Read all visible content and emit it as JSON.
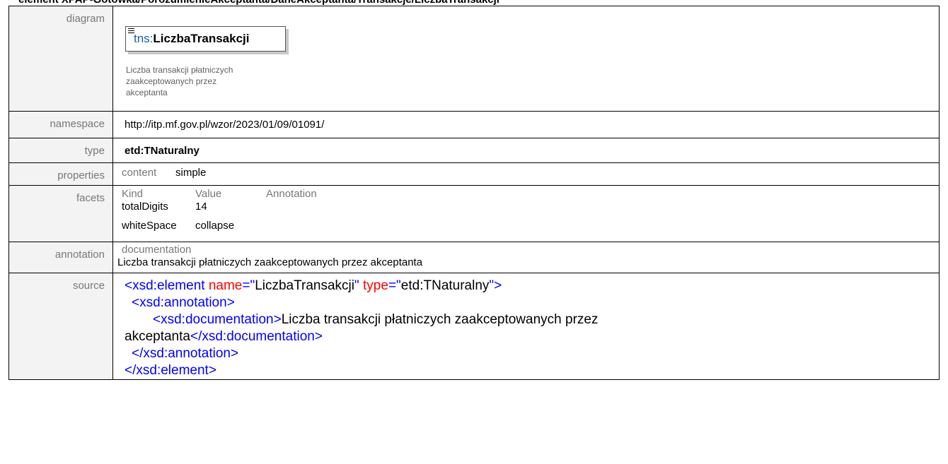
{
  "page": {
    "title": "element XPAP-Gotowka/PorozumienieAkceptanta/DaneAkceptanta/Transakcje/LiczbaTransakcji"
  },
  "labels": {
    "diagram": "diagram",
    "namespace": "namespace",
    "type": "type",
    "properties": "properties",
    "facets": "facets",
    "annotation": "annotation",
    "source": "source"
  },
  "diagram": {
    "prefix": "tns:",
    "name": "LiczbaTransakcji",
    "doc": "Liczba transakcji płatniczych zaakceptowanych przez akceptanta"
  },
  "namespace": "http://itp.mf.gov.pl/wzor/2023/01/09/01091/",
  "type": "etd:TNaturalny",
  "properties": {
    "key": "content",
    "value": "simple"
  },
  "facets": {
    "headers": [
      "Kind",
      "Value",
      "Annotation"
    ],
    "rows": [
      {
        "kind": "totalDigits",
        "value": "14"
      },
      {
        "kind": "whiteSpace",
        "value": "collapse"
      }
    ]
  },
  "annotation": {
    "head": "documentation",
    "text": "Liczba transakcji płatniczych zaakceptowanych przez akceptanta"
  },
  "source": {
    "l1_open": "<xsd:element",
    "l1_attr1": "name",
    "l1_eq1": "=\"",
    "l1_val1": "LiczbaTransakcji",
    "l1_q1": "\"",
    "l1_attr2": "type",
    "l1_eq2": "=\"",
    "l1_val2": "etd:TNaturalny",
    "l1_close": "\">",
    "l2": "<xsd:annotation>",
    "l3": "<xsd:documentation>",
    "l3_text": "Liczba transakcji płatniczych zaakceptowanych przez",
    "l4_text": "akceptanta",
    "l4_close": "</xsd:documentation>",
    "l5": "</xsd:annotation>",
    "l6": "</xsd:element>"
  }
}
